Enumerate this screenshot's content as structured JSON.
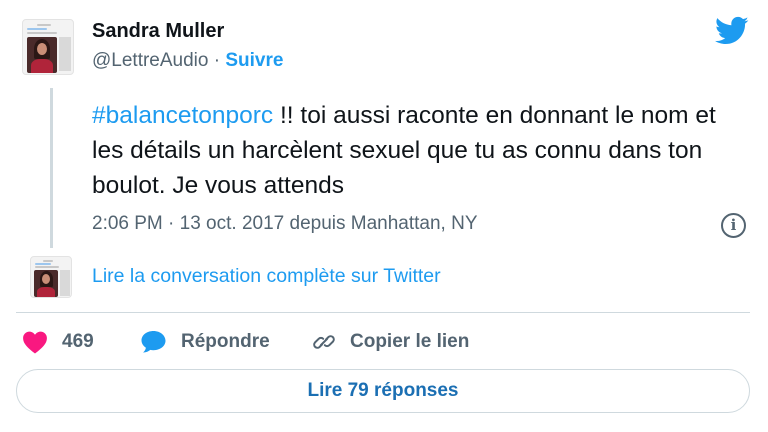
{
  "author": {
    "name": "Sandra Muller",
    "handle": "@LettreAudio",
    "separator": "·",
    "follow_label": "Suivre",
    "avatar_icon": "profile-photo-icon"
  },
  "brand": {
    "logo_icon": "twitter-bird-icon",
    "color": "#1d9bf0"
  },
  "tweet": {
    "hashtag": "#balancetonporc",
    "text": " !!  toi aussi raconte en donnant le nom et les détails un harcèlent sexuel que tu as connu dans ton boulot. Je vous attends",
    "timestamp": "2:06 PM · 13 oct. 2017 depuis Manhattan, NY",
    "info_icon": "info-icon"
  },
  "conversation": {
    "link_label": "Lire la conversation complète sur Twitter"
  },
  "actions": {
    "like_count": "469",
    "like_icon": "heart-icon",
    "like_color": "#f91880",
    "reply_label": "Répondre",
    "reply_icon": "speech-bubble-icon",
    "copy_label": "Copier le lien",
    "copy_icon": "link-icon"
  },
  "replies_button": {
    "label": "Lire 79 réponses"
  }
}
